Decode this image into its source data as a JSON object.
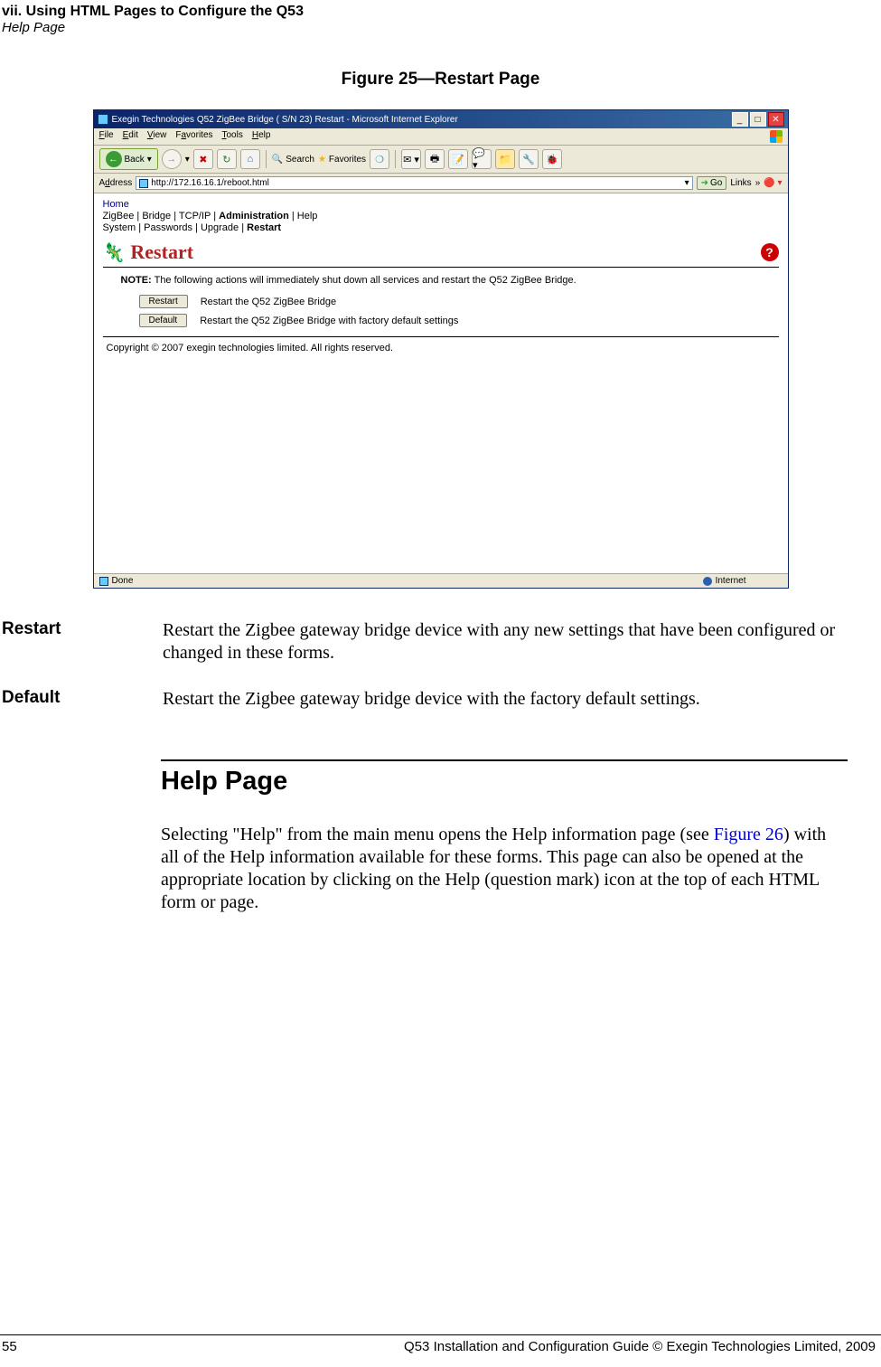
{
  "header": {
    "chapter": "vii. Using HTML Pages to Configure the Q53",
    "section": "Help Page"
  },
  "figure": {
    "caption": "Figure 25—Restart Page"
  },
  "ie": {
    "title": "Exegin Technologies Q52 ZigBee Bridge ( S/N 23) Restart - Microsoft Internet Explorer",
    "menu": {
      "file": "File",
      "edit": "Edit",
      "view": "View",
      "favorites": "Favorites",
      "tools": "Tools",
      "help": "Help"
    },
    "toolbar": {
      "back": "Back",
      "search": "Search",
      "favorites": "Favorites"
    },
    "address_label": "Address",
    "address_url": "http://172.16.16.1/reboot.html",
    "go": "Go",
    "links": "Links",
    "nav": {
      "home": "Home",
      "row1": {
        "zigbee": "ZigBee",
        "bridge": "Bridge",
        "tcpip": "TCP/IP",
        "admin": "Administration",
        "help": "Help"
      },
      "row2": {
        "system": "System",
        "passwords": "Passwords",
        "upgrade": "Upgrade",
        "restart": "Restart"
      }
    },
    "page": {
      "title": "Restart",
      "note_label": "NOTE:",
      "note_text": "The following actions will immediately shut down all services and restart the Q52 ZigBee Bridge.",
      "btn_restart": "Restart",
      "btn_restart_desc": "Restart the Q52 ZigBee Bridge",
      "btn_default": "Default",
      "btn_default_desc": "Restart the Q52 ZigBee Bridge with factory default settings",
      "copyright": "Copyright © 2007 exegin technologies limited. All rights reserved."
    },
    "status": {
      "done": "Done",
      "zone": "Internet"
    }
  },
  "defs": {
    "restart": {
      "term": "Restart",
      "desc": "Restart the Zigbee gateway bridge device with any new settings that have been configured or changed in these forms."
    },
    "default": {
      "term": "Default",
      "desc": "Restart the Zigbee gateway bridge device with the factory default settings."
    }
  },
  "section": {
    "title": "Help Page",
    "body_pre": "Selecting \"Help\" from the main menu opens the Help information page (see ",
    "figref": "Figure 26",
    "body_post": ") with all of the Help information available for these forms. This page can also be opened at the appropriate location by clicking on the Help (question mark) icon at the top of each HTML form or page."
  },
  "footer": {
    "pagenum": "55",
    "text": "Q53 Installation and Configuration Guide  © Exegin Technologies Limited, 2009"
  }
}
